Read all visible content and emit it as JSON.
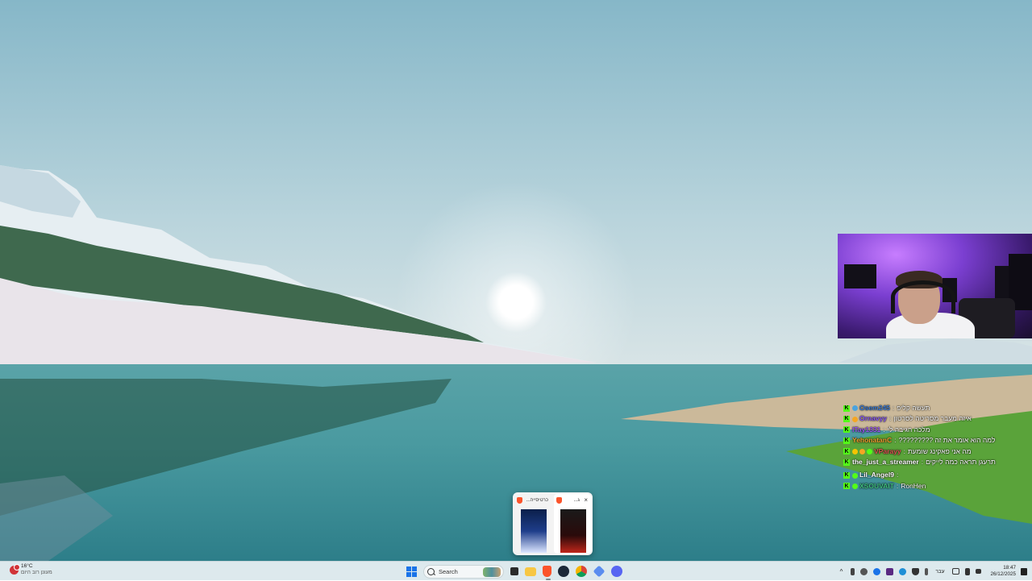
{
  "webcam": {
    "label": "webcam-overlay"
  },
  "chat": {
    "messages": [
      {
        "user": "Osem245",
        "sep": ":",
        "text": "תעשה קליפ",
        "color": "#3a7bd5",
        "badges": [
          "#4aa3df"
        ]
      },
      {
        "user": "Ornavyy",
        "sep": ":",
        "text": "איזה מעבר מסריטה לסרטון",
        "color": "#8a5cf5",
        "badges": [
          "#f5a623"
        ]
      },
      {
        "user": "ITay1331",
        "sep": ":",
        "text": "מלכה הגיבה לי",
        "color": "#9b59f6",
        "badges": []
      },
      {
        "user": "YehonatanC",
        "sep": ":",
        "text": "למה הוא אומר את זה ?????????",
        "color": "#f0a030",
        "badges": []
      },
      {
        "user": "VParayy",
        "sep": ":",
        "text": "מה אני פאקינג שומעת",
        "color": "#e05555",
        "badges": [
          "#f5c400",
          "#f5a623",
          "#53fc18"
        ]
      },
      {
        "user": "the_just_a_streamer",
        "sep": ":",
        "text": "תרעגן תראה כמה לייקים",
        "color": "#ffffff",
        "badges": []
      },
      {
        "user": "Lil_Angel9",
        "sep": ":",
        "text": "",
        "color": "#ffffff",
        "badges": [
          "#53fc18"
        ]
      },
      {
        "user": "XSOUVAIT",
        "sep": ":",
        "text": "RonHen",
        "color": "#3fbf7f",
        "badges": [
          "#53fc18"
        ]
      }
    ]
  },
  "tab_preview": {
    "tabs": [
      {
        "title": "כרטיסייה..."
      },
      {
        "title": "ג..."
      }
    ],
    "close_glyph": "×"
  },
  "taskbar": {
    "weather": {
      "temp": "16°C",
      "desc": "מעונן רוב היום"
    },
    "search": {
      "label": "Search"
    },
    "apps": [
      "windows-start-icon",
      "task-view-icon",
      "file-explorer-icon",
      "brave-browser-icon",
      "steam-icon",
      "chrome-icon",
      "vpn-icon",
      "discord-icon"
    ],
    "language": "עבר",
    "clock": {
      "time": "18:47",
      "date": "26/12/2025"
    },
    "tray_up": "^"
  }
}
